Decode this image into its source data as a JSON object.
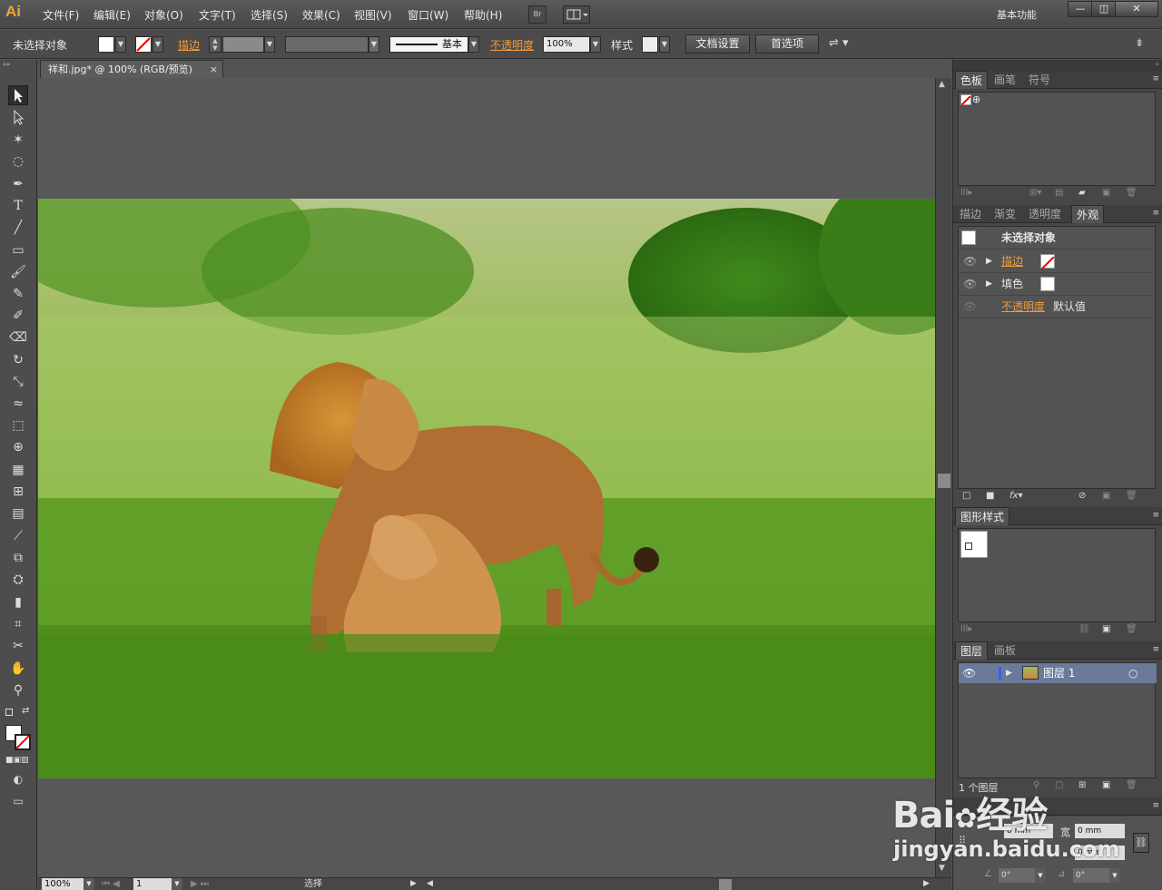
{
  "app": {
    "logo": "Ai",
    "workspace": "基本功能"
  },
  "menu": [
    "文件(F)",
    "编辑(E)",
    "对象(O)",
    "文字(T)",
    "选择(S)",
    "效果(C)",
    "视图(V)",
    "窗口(W)",
    "帮助(H)"
  ],
  "menubar": {
    "bridge": "Br"
  },
  "window_controls": {
    "minimize": "—",
    "restore": "◫",
    "close": "✕"
  },
  "control": {
    "no_selection": "未选择对象",
    "stroke_label": "描边",
    "stroke_style": "基本",
    "opacity_label": "不透明度",
    "opacity_value": "100%",
    "style_label": "样式",
    "doc_setup": "文档设置",
    "prefs": "首选项"
  },
  "document": {
    "tab": "祥和.jpg* @ 100% (RGB/预览)",
    "close": "×"
  },
  "status": {
    "zoom": "100%",
    "artboard": "1",
    "tool": "选择"
  },
  "panels": {
    "swatches_tabs": [
      "色板",
      "画笔",
      "符号"
    ],
    "appearance_tabs": [
      "描边",
      "渐变",
      "透明度",
      "外观"
    ],
    "appearance": {
      "header": "未选择对象",
      "stroke": "描边",
      "fill": "填色",
      "opacity": "不透明度",
      "opacity_value": "默认值"
    },
    "graphic_styles_tab": "图形样式",
    "layers_tabs": [
      "图层",
      "画板"
    ],
    "layer_name": "图层 1",
    "layers_count": "1 个图层",
    "transform": {
      "x_unit": "0 mm",
      "w_label": "宽",
      "w_value": "0 mm",
      "h_value": "0 mm",
      "angle": "0°",
      "shear": "0°"
    }
  },
  "watermark": {
    "brand": "Bai",
    "brand2": "经验",
    "url": "jingyan.baidu.com"
  },
  "colors": {
    "accent": "#f09a3e",
    "panel": "#535353",
    "ui": "#474747"
  }
}
